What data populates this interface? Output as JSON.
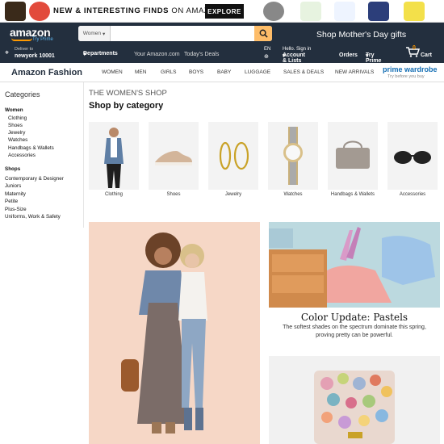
{
  "promo": {
    "lead": "NEW & INTERESTING FINDS",
    "on": "ON AMAZON",
    "explore_label": "EXPLORE"
  },
  "header": {
    "logo": "amazon",
    "try_prime": "Try Prime",
    "search_category": "Women",
    "search_placeholder": "",
    "mothers_day": "Shop Mother's Day gifts",
    "deliver_to": "Deliver to",
    "deliver_location": "newyork 10001",
    "departments": "Departments",
    "your_amazon": "Your Amazon.com",
    "todays_deals": "Today's Deals",
    "lang": "EN",
    "hello": "Hello. Sign in",
    "account": "Account & Lists",
    "orders": "Orders",
    "try_prime_menu": "Try Prime",
    "cart_count": "0",
    "cart": "Cart"
  },
  "subnav": {
    "brand": "Amazon Fashion",
    "links": [
      "WOMEN",
      "MEN",
      "GIRLS",
      "BOYS",
      "BABY",
      "LUGGAGE",
      "SALES & DEALS",
      "NEW ARRIVALS"
    ],
    "prime_wardrobe": "prime wardrobe",
    "prime_wardrobe_tag": "Try before you buy"
  },
  "sidebar": {
    "heading": "Categories",
    "women": "Women",
    "women_items": [
      "Clothing",
      "Shoes",
      "Jewelry",
      "Watches",
      "Handbags & Wallets",
      "Accessories"
    ],
    "shops": "Shops",
    "shop_items": [
      "Contemporary & Designer",
      "Juniors",
      "Maternity",
      "Petite",
      "Plus-Size",
      "Uniforms, Work & Safety"
    ]
  },
  "main": {
    "eyebrow": "THE WOMEN'S SHOP",
    "title": "Shop by category",
    "categories": [
      "Clothing",
      "Shoes",
      "Jewelry",
      "Watches",
      "Handbags & Wallets",
      "Accessories"
    ],
    "feature_title": "Color Update: Pastels",
    "feature_desc": "The softest shades on the spectrum dominate this spring, proving pretty can be powerful."
  },
  "colors": {
    "nav": "#232f3e",
    "accent": "#febd69",
    "prime_blue": "#146eb4"
  }
}
